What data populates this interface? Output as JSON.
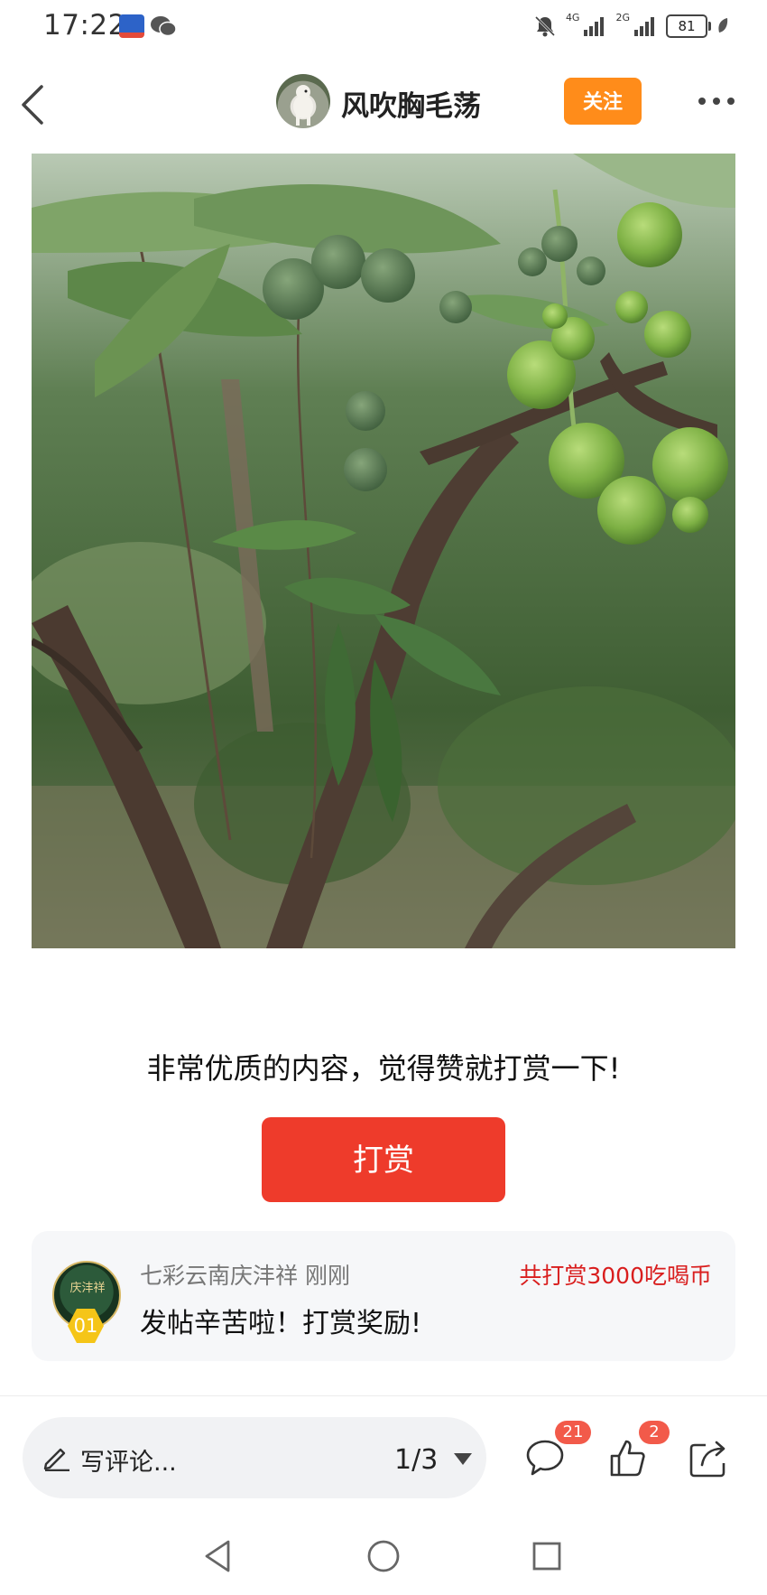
{
  "status_bar": {
    "time": "17:22",
    "battery": "81",
    "network_1": "4G",
    "network_2": "2G"
  },
  "header": {
    "author_name": "风吹胸毛荡",
    "follow_label": "关注"
  },
  "post": {
    "reward_prompt": "非常优质的内容，觉得赞就打赏一下!",
    "reward_button_label": "打赏"
  },
  "reward_record": {
    "tipper": "七彩云南庆沣祥 刚刚",
    "amount": "共打赏3000吃喝币",
    "message": "发帖辛苦啦！打赏奖励!",
    "rank": "01",
    "avatar_text": "庆沣祥"
  },
  "bottom_bar": {
    "comment_placeholder": "写评论...",
    "page_indicator": "1/3",
    "comment_count": "21",
    "like_count": "2"
  },
  "colors": {
    "follow": "#ff8c1a",
    "reward": "#ee3b2b",
    "amount_text": "#d91e1e",
    "badge": "#f25a4a"
  }
}
